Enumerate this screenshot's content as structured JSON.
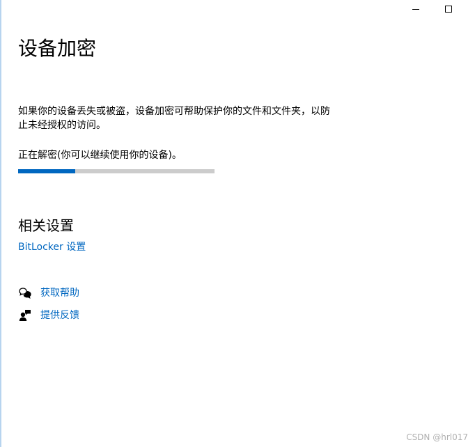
{
  "page": {
    "title": "设备加密",
    "description": "如果你的设备丢失或被盗，设备加密可帮助保护你的文件和文件夹，以防止未经授权的访问。",
    "status": "正在解密(你可以继续使用你的设备)。",
    "progress_fraction": 0.29
  },
  "related": {
    "heading": "相关设置",
    "bitlocker_link": "BitLocker 设置"
  },
  "help": {
    "get_help_label": "获取帮助",
    "get_help_icon": "chat-bubbles-icon",
    "feedback_label": "提供反馈",
    "feedback_icon": "feedback-person-icon"
  },
  "watermark": "CSDN @hrl017",
  "colors": {
    "accent": "#0067c0",
    "progress_track": "#cccccc",
    "window_border": "#b7d4ef"
  }
}
